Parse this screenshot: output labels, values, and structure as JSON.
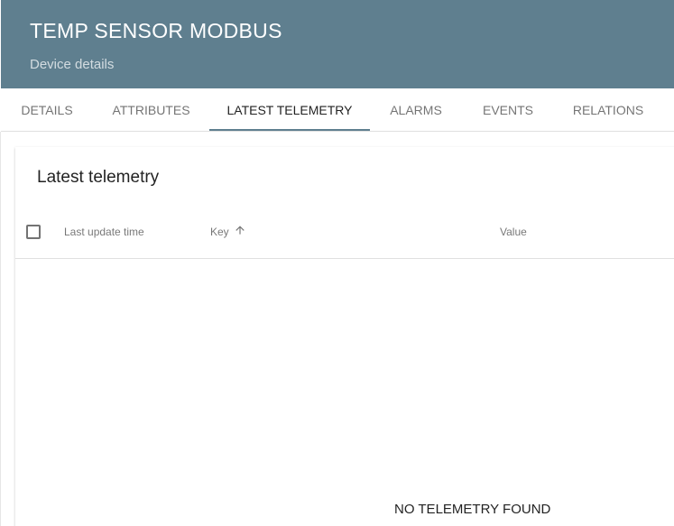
{
  "header": {
    "title": "TEMP SENSOR MODBUS",
    "subtitle": "Device details",
    "background_color": "#5f7f8f"
  },
  "tabs": [
    {
      "label": "DETAILS",
      "active": false
    },
    {
      "label": "ATTRIBUTES",
      "active": false
    },
    {
      "label": "LATEST TELEMETRY",
      "active": true
    },
    {
      "label": "ALARMS",
      "active": false
    },
    {
      "label": "EVENTS",
      "active": false
    },
    {
      "label": "RELATIONS",
      "active": false
    }
  ],
  "telemetry": {
    "title": "Latest telemetry",
    "columns": {
      "last_update_time": "Last update time",
      "key": "Key",
      "value": "Value"
    },
    "sort_icon": "arrow-upward-icon",
    "rows": [],
    "empty_message": "NO TELEMETRY FOUND"
  }
}
